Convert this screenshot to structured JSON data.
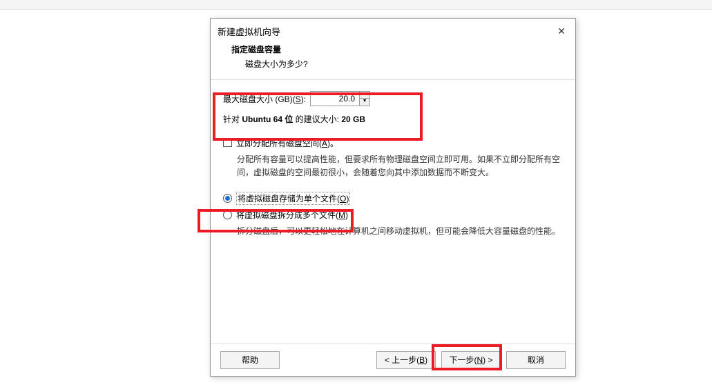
{
  "dialog": {
    "title": "新建虚拟机向导",
    "heading": "指定磁盘容量",
    "subheading": "磁盘大小为多少?"
  },
  "disk": {
    "max_label_pre": "最大磁盘大小 (GB)(",
    "max_label_key": "S",
    "max_label_post": "):",
    "max_value": "20.0",
    "recommend_pre": "针对 ",
    "recommend_os": "Ubuntu 64 位",
    "recommend_mid": " 的建议大小: ",
    "recommend_size": "20 GB"
  },
  "allocate": {
    "label_pre": "立即分配所有磁盘空间(",
    "label_key": "A",
    "label_post": ")。",
    "desc": "分配所有容量可以提高性能，但要求所有物理磁盘空间立即可用。如果不立即分配所有空间，虚拟磁盘的空间最初很小，会随着您向其中添加数据而不断变大。"
  },
  "store": {
    "single_pre": "将虚拟磁盘存储为单个文件(",
    "single_key": "O",
    "single_post": ")",
    "split_pre": "将虚拟磁盘拆分成多个文件(",
    "split_key": "M",
    "split_post": ")",
    "split_desc": "拆分磁盘后，可以更轻松地在计算机之间移动虚拟机，但可能会降低大容量磁盘的性能。"
  },
  "buttons": {
    "help": "帮助",
    "back_pre": "< 上一步(",
    "back_key": "B",
    "back_post": ")",
    "next_pre": "下一步(",
    "next_key": "N",
    "next_post": ") >",
    "cancel": "取消"
  }
}
